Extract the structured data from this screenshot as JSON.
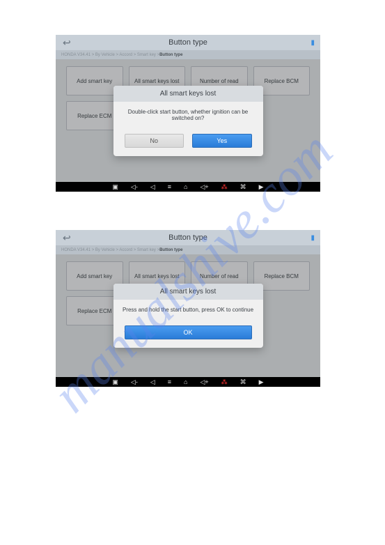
{
  "watermark": "manualshive.com",
  "screens": [
    {
      "header_title": "Button type",
      "breadcrumb": "HONDA V34.41 > By Vehicle > Accord > Smart key > ",
      "breadcrumb_current": "Button type",
      "tiles": [
        "Add smart key",
        "All smart keys lost",
        "Number of read",
        "Replace BCM",
        "Replace ECM",
        "",
        "",
        ""
      ],
      "modal": {
        "title": "All smart keys lost",
        "body": "Double-click start button, whether ignition can be switched on?",
        "buttons": [
          {
            "label": "No",
            "type": "secondary"
          },
          {
            "label": "Yes",
            "type": "primary"
          }
        ]
      }
    },
    {
      "header_title": "Button type",
      "breadcrumb": "HONDA V34.41 > By Vehicle > Accord > Smart key > ",
      "breadcrumb_current": "Button type",
      "tiles": [
        "Add smart key",
        "All smart keys lost",
        "Number of read",
        "Replace BCM",
        "Replace ECM",
        "",
        "",
        ""
      ],
      "modal": {
        "title": "All smart keys lost",
        "body": "Press and hold the start button, press OK to continue",
        "buttons": [
          {
            "label": "OK",
            "type": "primary"
          }
        ]
      }
    }
  ],
  "nav_icons": [
    "camera",
    "volume-down",
    "back",
    "menu",
    "home",
    "volume-up",
    "bluetooth",
    "apps",
    "screenshot"
  ]
}
